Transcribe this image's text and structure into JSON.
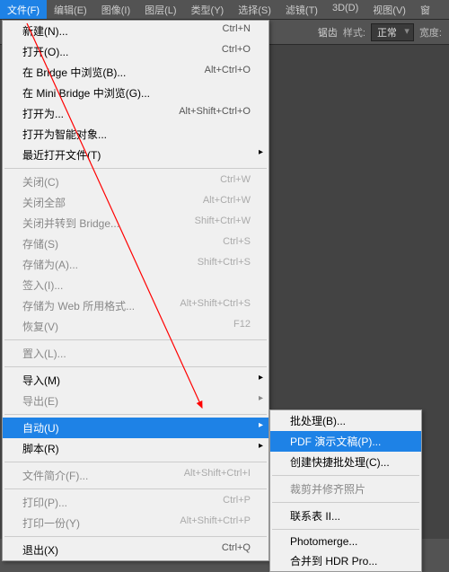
{
  "menubar": {
    "items": [
      {
        "label": "文件(F)",
        "open": true
      },
      {
        "label": "编辑(E)"
      },
      {
        "label": "图像(I)"
      },
      {
        "label": "图层(L)"
      },
      {
        "label": "类型(Y)"
      },
      {
        "label": "选择(S)"
      },
      {
        "label": "滤镜(T)"
      },
      {
        "label": "3D(D)"
      },
      {
        "label": "视图(V)"
      },
      {
        "label": "窗"
      }
    ]
  },
  "toolbar": {
    "anti_alias": "锯齿",
    "style_label": "样式:",
    "style_value": "正常",
    "width_label": "宽度:"
  },
  "file_menu": [
    {
      "label": "新建(N)...",
      "shortcut": "Ctrl+N"
    },
    {
      "label": "打开(O)...",
      "shortcut": "Ctrl+O"
    },
    {
      "label": "在 Bridge 中浏览(B)...",
      "shortcut": "Alt+Ctrl+O"
    },
    {
      "label": "在 Mini Bridge 中浏览(G)..."
    },
    {
      "label": "打开为...",
      "shortcut": "Alt+Shift+Ctrl+O"
    },
    {
      "label": "打开为智能对象..."
    },
    {
      "label": "最近打开文件(T)",
      "submenu": true
    },
    {
      "sep": true
    },
    {
      "label": "关闭(C)",
      "shortcut": "Ctrl+W",
      "disabled": true
    },
    {
      "label": "关闭全部",
      "shortcut": "Alt+Ctrl+W",
      "disabled": true
    },
    {
      "label": "关闭并转到 Bridge...",
      "shortcut": "Shift+Ctrl+W",
      "disabled": true
    },
    {
      "label": "存储(S)",
      "shortcut": "Ctrl+S",
      "disabled": true
    },
    {
      "label": "存储为(A)...",
      "shortcut": "Shift+Ctrl+S",
      "disabled": true
    },
    {
      "label": "签入(I)...",
      "disabled": true
    },
    {
      "label": "存储为 Web 所用格式...",
      "shortcut": "Alt+Shift+Ctrl+S",
      "disabled": true
    },
    {
      "label": "恢复(V)",
      "shortcut": "F12",
      "disabled": true
    },
    {
      "sep": true
    },
    {
      "label": "置入(L)...",
      "disabled": true
    },
    {
      "sep": true
    },
    {
      "label": "导入(M)",
      "submenu": true
    },
    {
      "label": "导出(E)",
      "submenu": true,
      "disabled": true
    },
    {
      "sep": true
    },
    {
      "label": "自动(U)",
      "submenu": true,
      "hover": true
    },
    {
      "label": "脚本(R)",
      "submenu": true
    },
    {
      "sep": true
    },
    {
      "label": "文件简介(F)...",
      "shortcut": "Alt+Shift+Ctrl+I",
      "disabled": true
    },
    {
      "sep": true
    },
    {
      "label": "打印(P)...",
      "shortcut": "Ctrl+P",
      "disabled": true
    },
    {
      "label": "打印一份(Y)",
      "shortcut": "Alt+Shift+Ctrl+P",
      "disabled": true
    },
    {
      "sep": true
    },
    {
      "label": "退出(X)",
      "shortcut": "Ctrl+Q"
    }
  ],
  "auto_submenu": [
    {
      "label": "批处理(B)..."
    },
    {
      "label": "PDF 演示文稿(P)...",
      "hover": true
    },
    {
      "label": "创建快捷批处理(C)..."
    },
    {
      "sep": true
    },
    {
      "label": "裁剪并修齐照片",
      "disabled": true
    },
    {
      "sep": true
    },
    {
      "label": "联系表 II..."
    },
    {
      "sep": true
    },
    {
      "label": "Photomerge..."
    },
    {
      "label": "合并到 HDR Pro..."
    }
  ]
}
